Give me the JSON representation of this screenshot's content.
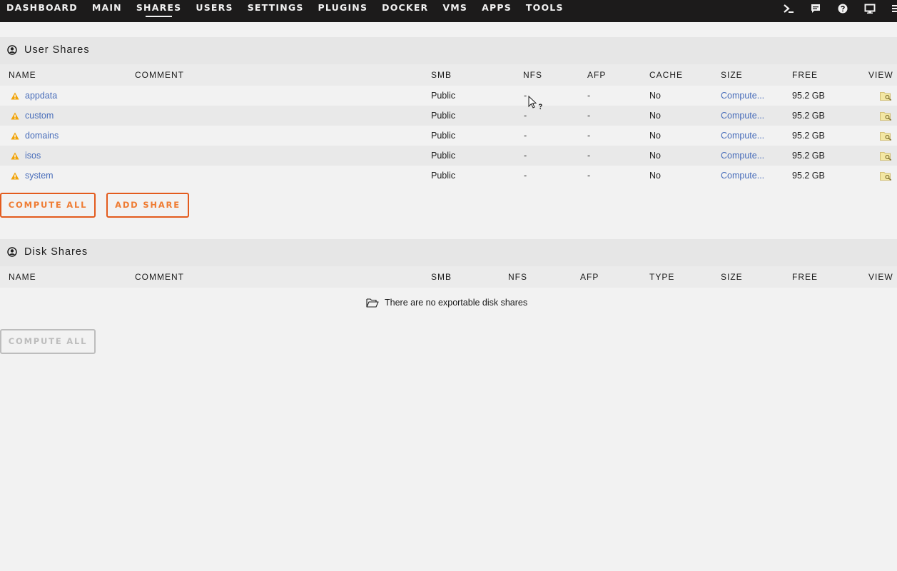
{
  "nav": {
    "items": [
      {
        "label": "DASHBOARD"
      },
      {
        "label": "MAIN"
      },
      {
        "label": "SHARES"
      },
      {
        "label": "USERS"
      },
      {
        "label": "SETTINGS"
      },
      {
        "label": "PLUGINS"
      },
      {
        "label": "DOCKER"
      },
      {
        "label": "VMS"
      },
      {
        "label": "APPS"
      },
      {
        "label": "TOOLS"
      }
    ],
    "active": "SHARES",
    "icons": [
      "terminal-icon",
      "feedback-icon",
      "help-icon",
      "monitor-icon",
      "log-icon"
    ]
  },
  "user_shares": {
    "title": "User Shares",
    "columns": {
      "name": "NAME",
      "comment": "COMMENT",
      "smb": "SMB",
      "nfs": "NFS",
      "afp": "AFP",
      "cache": "CACHE",
      "size": "SIZE",
      "free": "FREE",
      "view": "VIEW"
    },
    "rows": [
      {
        "name": "appdata",
        "comment": "",
        "smb": "Public",
        "nfs": "-",
        "afp": "-",
        "cache": "No",
        "size": "Compute...",
        "free": "95.2 GB"
      },
      {
        "name": "custom",
        "comment": "",
        "smb": "Public",
        "nfs": "-",
        "afp": "-",
        "cache": "No",
        "size": "Compute...",
        "free": "95.2 GB"
      },
      {
        "name": "domains",
        "comment": "",
        "smb": "Public",
        "nfs": "-",
        "afp": "-",
        "cache": "No",
        "size": "Compute...",
        "free": "95.2 GB"
      },
      {
        "name": "isos",
        "comment": "",
        "smb": "Public",
        "nfs": "-",
        "afp": "-",
        "cache": "No",
        "size": "Compute...",
        "free": "95.2 GB"
      },
      {
        "name": "system",
        "comment": "",
        "smb": "Public",
        "nfs": "-",
        "afp": "-",
        "cache": "No",
        "size": "Compute...",
        "free": "95.2 GB"
      }
    ],
    "buttons": {
      "compute_all": "COMPUTE ALL",
      "add_share": "ADD SHARE"
    }
  },
  "disk_shares": {
    "title": "Disk Shares",
    "columns": {
      "name": "NAME",
      "comment": "COMMENT",
      "smb": "SMB",
      "nfs": "NFS",
      "afp": "AFP",
      "type": "TYPE",
      "size": "SIZE",
      "free": "FREE",
      "view": "VIEW"
    },
    "empty_message": "There are no exportable disk shares",
    "buttons": {
      "compute_all": "COMPUTE ALL"
    }
  },
  "colors": {
    "nav_bg": "#1c1b1b",
    "accent": "#e35b1d",
    "accent_text": "#ef7c33",
    "link": "#486dba",
    "warning": "#f0a30a"
  }
}
